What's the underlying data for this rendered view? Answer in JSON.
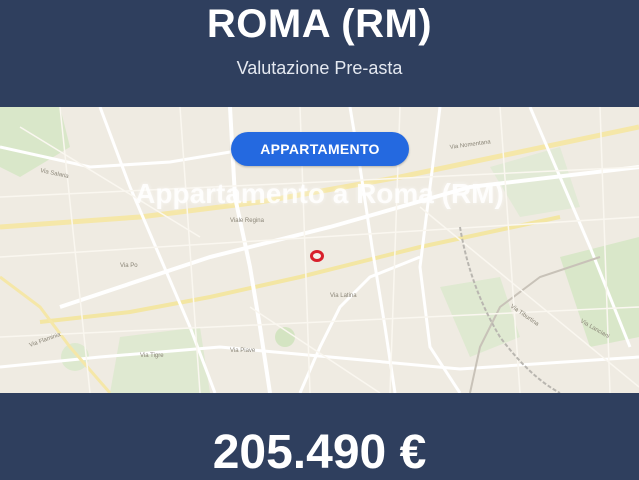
{
  "header": {
    "city": "ROMA (RM)",
    "subtitle": "Valutazione Pre-asta"
  },
  "map": {
    "badge": "APPARTAMENTO",
    "title": "Appartamento a Roma (RM)",
    "marker": "location-marker",
    "street_labels": [
      "Via Nomentana",
      "Via Salaria",
      "Viale Regina",
      "Via Tiburtina",
      "Via Po",
      "Via Flaminia",
      "Via Latina",
      "Via Lanciani",
      "Via Piave",
      "Via Tigre"
    ]
  },
  "footer": {
    "price": "205.490 €"
  },
  "colors": {
    "header_bg": "#2f3f5e",
    "badge_bg": "#2469e0",
    "marker": "#d8202c",
    "map_bg": "#efebe2"
  }
}
